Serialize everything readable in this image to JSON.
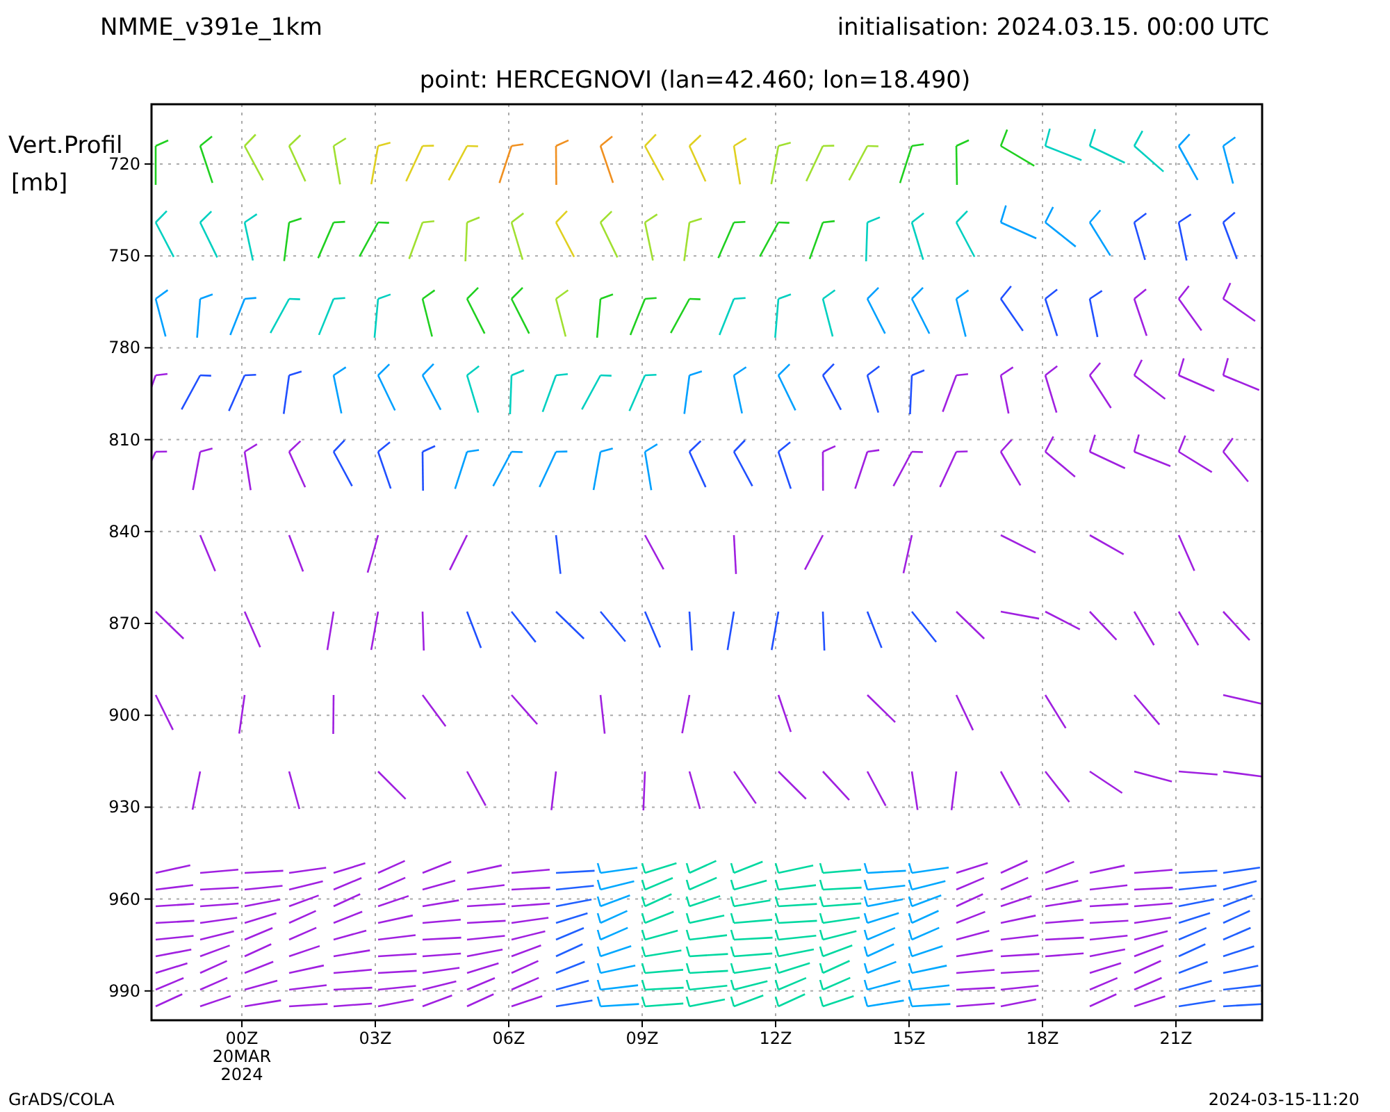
{
  "header": {
    "model": "NMME_v391e_1km",
    "initialisation": "initialisation: 2024.03.15. 00:00 UTC",
    "point": "point: HERCEGNOVI (lan=42.460; lon=18.490)"
  },
  "plot": {
    "ylabel": [
      "Vert.Profil",
      "[mb]"
    ],
    "yticks": [
      "720",
      "750",
      "780",
      "810",
      "840",
      "870",
      "900",
      "930",
      "960",
      "990"
    ],
    "xticks": [
      {
        "lines": [
          "00Z",
          "20MAR",
          "2024"
        ]
      },
      {
        "lines": [
          "03Z"
        ]
      },
      {
        "lines": [
          "06Z"
        ]
      },
      {
        "lines": [
          "09Z"
        ]
      },
      {
        "lines": [
          "12Z"
        ]
      },
      {
        "lines": [
          "15Z"
        ]
      },
      {
        "lines": [
          "18Z"
        ]
      },
      {
        "lines": [
          "21Z"
        ]
      }
    ]
  },
  "footer": {
    "left": "GrADS/COLA",
    "right": "2024-03-15-11:20"
  }
}
